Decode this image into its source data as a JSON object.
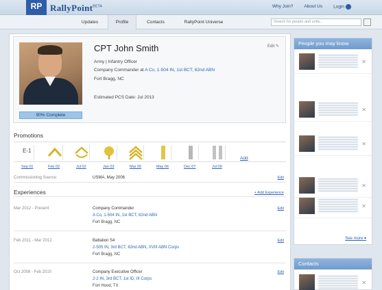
{
  "header": {
    "logo_initials": "RP",
    "brand": "RallyPoint",
    "brand_tag": "BETA",
    "links": [
      "Why Join?",
      "About Us",
      "Login"
    ],
    "login_icon": "arrow-right-icon"
  },
  "subnav": {
    "tabs": [
      "Updates",
      "Profile",
      "Contacts",
      "RallyPoint Universe"
    ],
    "active_tab": "Profile",
    "search_placeholder": "Search for people and units..."
  },
  "profile": {
    "name": "CPT John Smith",
    "branch": "Army | Infantry Officer",
    "role_prefix": "Company Commander at",
    "units": [
      "A Co, 1-504 IN",
      "1st BCT",
      "82nd ABN"
    ],
    "location": "Fort Bragg, NC",
    "pcs": "Estimated PCS Date: Jul 2013",
    "progress_label": "90% Complete",
    "progress_value": 0.9,
    "edit": "Edit"
  },
  "promotions": {
    "title": "Promotions",
    "first_rank": "E-1",
    "dates": [
      "Sep 01",
      "Feb 02",
      "Jul 02",
      "Jan 03",
      "Mar 05",
      "May 06",
      "Dec 07",
      "Jul 09"
    ],
    "add": "Add",
    "commissioning_label": "Commissioning Source:",
    "commissioning_value": "USMA, May 2006",
    "edit": "Edit"
  },
  "experiences": {
    "title": "Experiences",
    "add": "+ Add Experience",
    "items": [
      {
        "dates": "Mar 2012 - Present",
        "title": "Company Commander",
        "units": "A Co, 1-504 IN, 1st BCT, 82nd ABN",
        "location": "Fort Bragg, NC",
        "edit": "Edit"
      },
      {
        "dates": "Feb 2011 - Mar 2012",
        "title": "Battalion S4",
        "units": "2-505 IN, 3rd BCT, 82nd ABN, XVIII ABN Corps",
        "location": "Fort Bragg, NC",
        "edit": "Edit"
      },
      {
        "dates": "Oct 2008 - Feb 2010",
        "title": "Company Executive Officer",
        "units": "2-2 IN, 3rd BCT, 1st ID, III Corps",
        "location": "Fort Hood, TX",
        "edit": "Edit"
      }
    ]
  },
  "sidebar": {
    "people_title": "People you may know",
    "people_count": 5,
    "see_more": "See more",
    "contacts_title": "Contacts"
  },
  "colors": {
    "accent": "#2d5ea6",
    "panel_header": "#7ea8d6",
    "link": "#2b62b3",
    "progress": "#9cc5ea"
  }
}
